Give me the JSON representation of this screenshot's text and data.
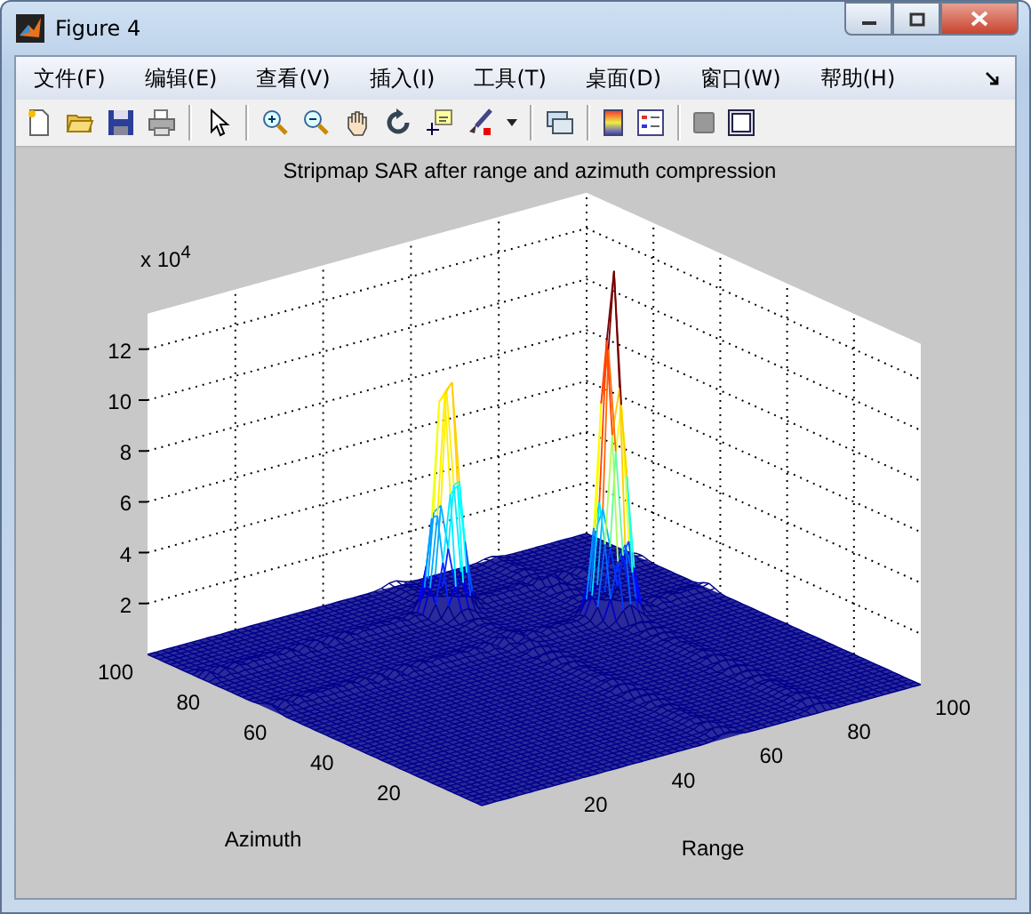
{
  "window": {
    "title": "Figure 4"
  },
  "menu": [
    "文件(F)",
    "编辑(E)",
    "查看(V)",
    "插入(I)",
    "工具(T)",
    "桌面(D)",
    "窗口(W)",
    "帮助(H)"
  ],
  "plot": {
    "title": "Stripmap SAR after range and azimuth compression",
    "exponent": "x 10$^{4}$",
    "z_ticks": [
      "12",
      "10",
      "8",
      "6",
      "4",
      "2"
    ],
    "azimuth_ticks": [
      "100",
      "80",
      "60",
      "40",
      "20"
    ],
    "range_ticks": [
      "20",
      "40",
      "60",
      "80",
      "100"
    ],
    "azimuth_label": "Azimuth",
    "range_label": "Range"
  }
}
